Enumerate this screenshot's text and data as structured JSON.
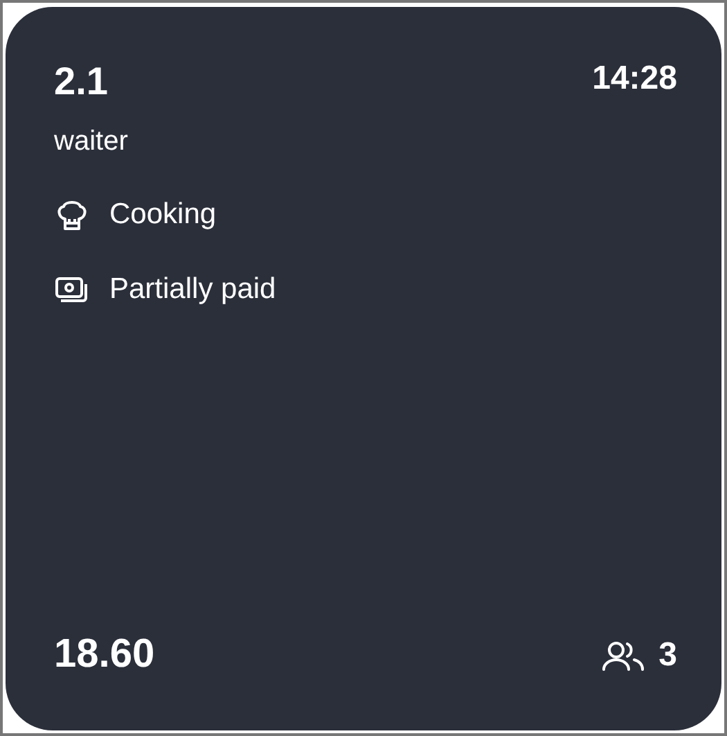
{
  "card": {
    "table": "2.1",
    "time": "14:28",
    "waiter": "waiter",
    "statuses": [
      {
        "kind": "cooking",
        "label": "Cooking"
      },
      {
        "kind": "payment",
        "label": "Partially paid"
      }
    ],
    "total": "18.60",
    "guests": "3"
  }
}
